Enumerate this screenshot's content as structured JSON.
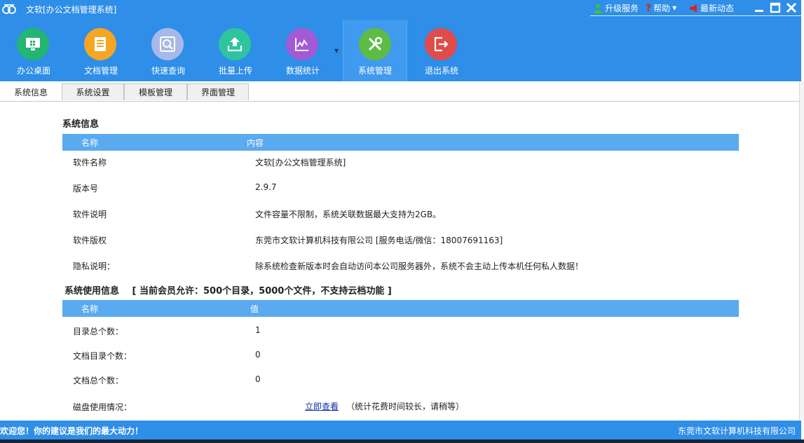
{
  "window": {
    "title": "文软[办公文档管理系统]",
    "links": {
      "upgrade": "升级服务",
      "help": "帮助",
      "news": "最新动态"
    }
  },
  "toolbar": {
    "items": [
      {
        "label": "办公桌面",
        "icon": "desktop-icon",
        "color": "#22b573"
      },
      {
        "label": "文档管理",
        "icon": "document-icon",
        "color": "#f5a623"
      },
      {
        "label": "快速查询",
        "icon": "search-icon",
        "color": "#a8b8e8"
      },
      {
        "label": "批量上传",
        "icon": "upload-icon",
        "color": "#2ec4a0"
      },
      {
        "label": "数据统计",
        "icon": "chart-icon",
        "color": "#a35ad6"
      },
      {
        "label": "系统管理",
        "icon": "tools-icon",
        "color": "#5dbb46"
      },
      {
        "label": "退出系统",
        "icon": "exit-icon",
        "color": "#e04b4b"
      }
    ],
    "active": "系统管理"
  },
  "tabs": [
    "系统信息",
    "系统设置",
    "模板管理",
    "界面管理"
  ],
  "active_tab": "系统信息",
  "system_info": {
    "title": "系统信息",
    "headers": [
      "名称",
      "内容"
    ],
    "rows": [
      {
        "name": "软件名称",
        "value": "文软[办公文档管理系统]"
      },
      {
        "name": "版本号",
        "value": "2.9.7"
      },
      {
        "name": "软件说明",
        "value": "文件容量不限制，系统关联数据最大支持为2GB。"
      },
      {
        "name": "软件版权",
        "value": "东莞市文软计算机科技有限公司 [服务电话/微信：18007691163]"
      },
      {
        "name": "隐私说明：",
        "value": "除系统检查新版本时会自动访问本公司服务器外，系统不会主动上传本机任何私人数据！"
      }
    ]
  },
  "usage_info": {
    "title": "系统使用信息",
    "notice": "[ 当前会员允许：500个目录，5000个文件，不支持云档功能 ]",
    "headers": [
      "名称",
      "值"
    ],
    "rows": [
      {
        "name": "目录总个数：",
        "value": "1"
      },
      {
        "name": "文档目录个数：",
        "value": "0"
      },
      {
        "name": "文档总个数：",
        "value": "0"
      }
    ],
    "disk": {
      "name": "磁盘使用情况：",
      "link": "立即查看",
      "note": "（统计花费时间较长，请稍等）"
    }
  },
  "statusbar": {
    "left": "欢迎您！你的建议是我们的最大动力！",
    "right": "东莞市文软计算机科技有限公司"
  }
}
